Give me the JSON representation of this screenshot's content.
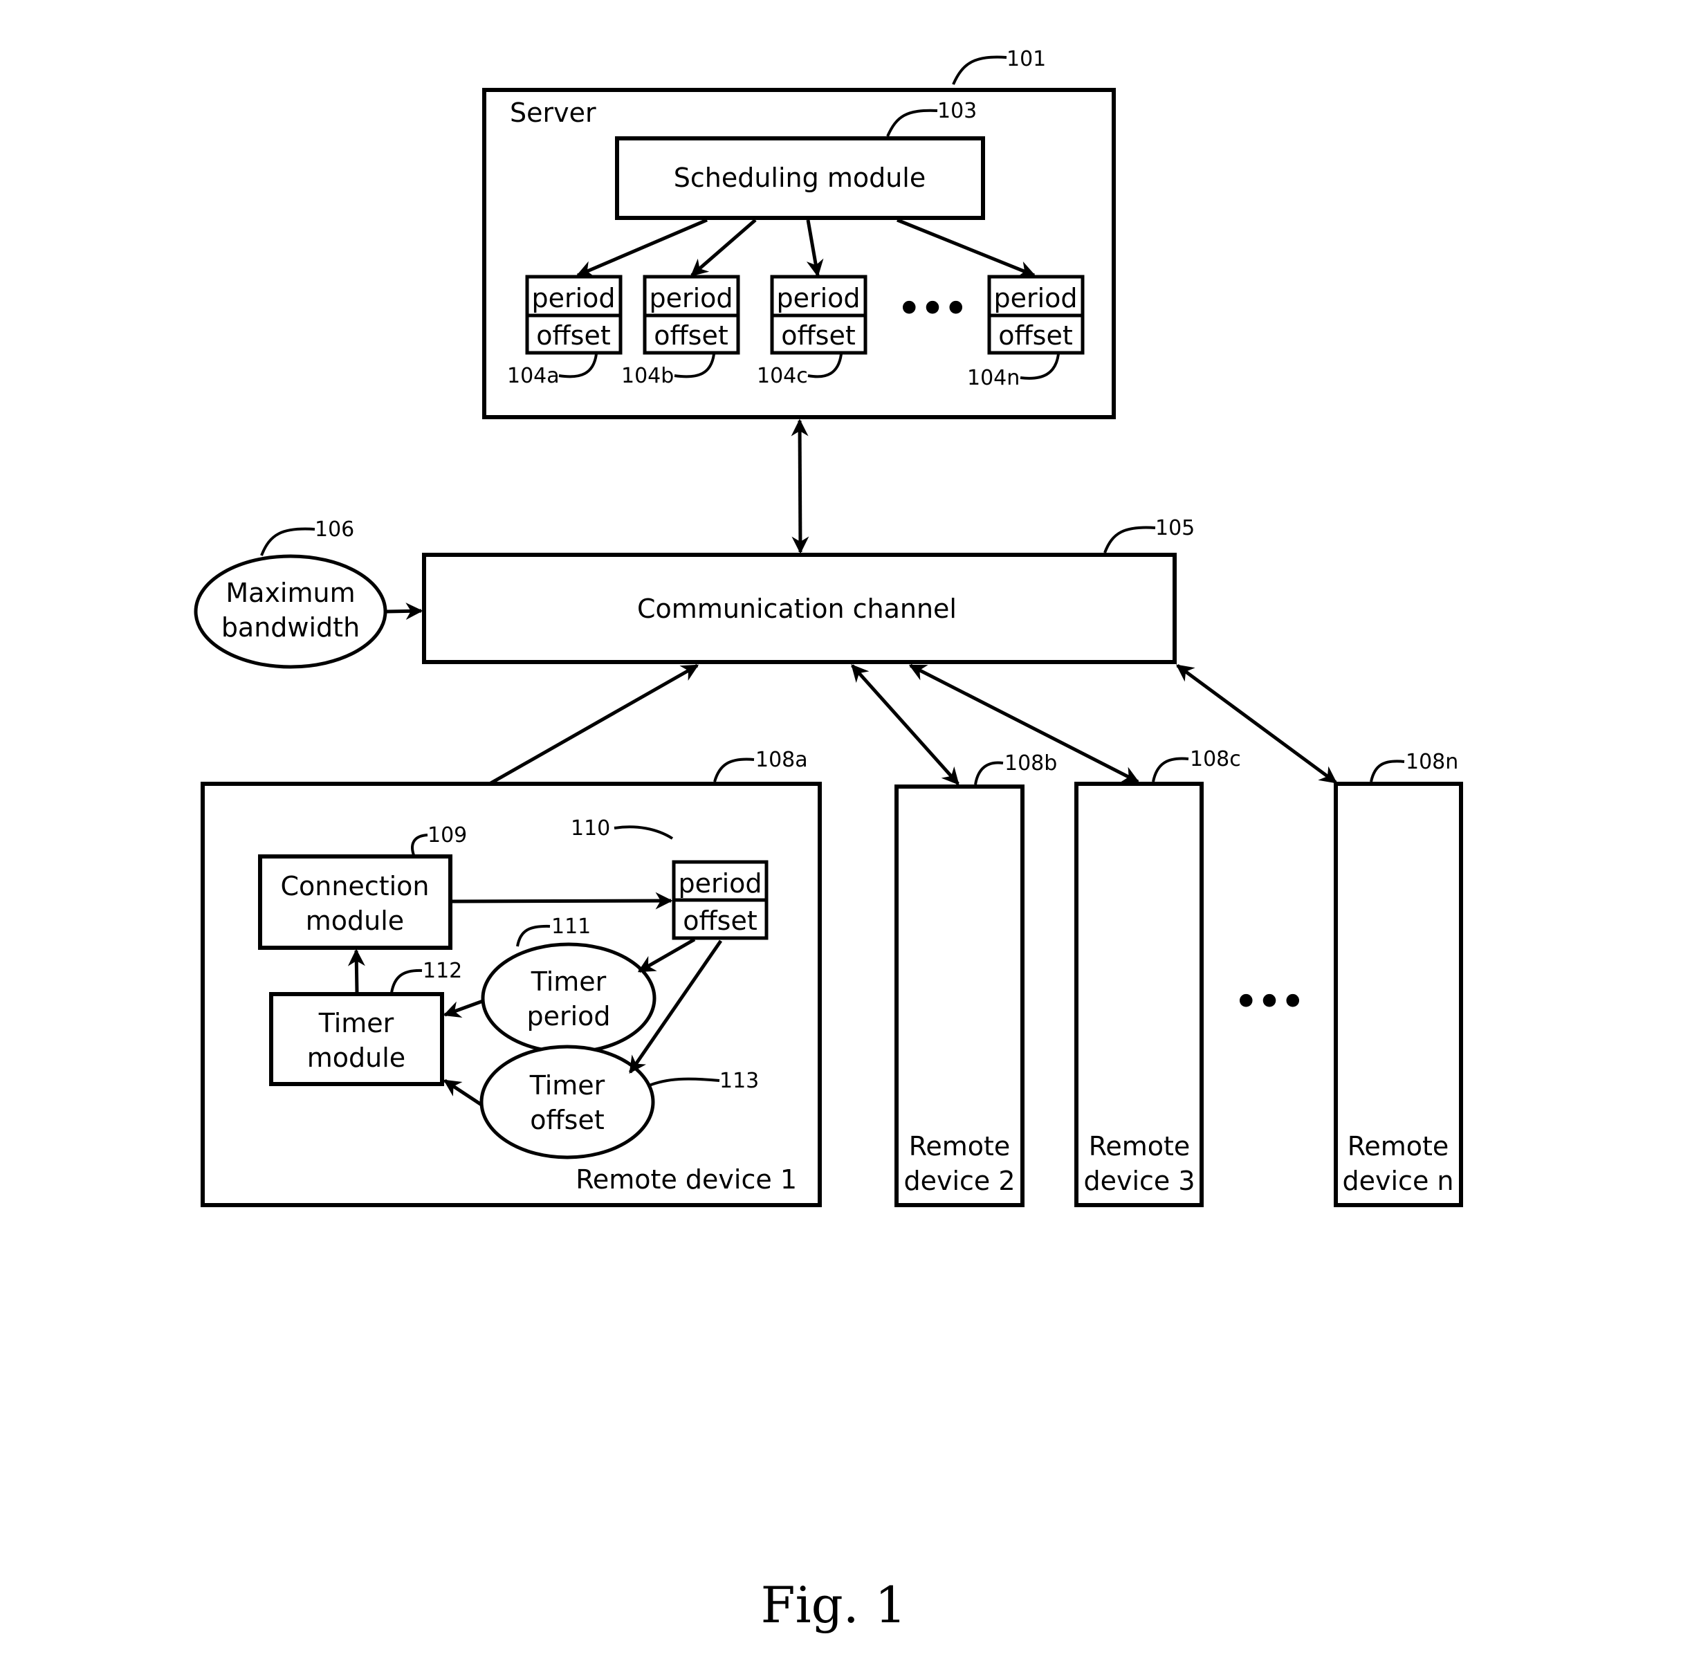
{
  "figure": {
    "caption": "Fig. 1",
    "colors": {
      "ink": "#000000",
      "paper": "#ffffff"
    }
  },
  "server": {
    "label": "Server",
    "ref": "101",
    "scheduling_module": {
      "label": "Scheduling module",
      "ref": "103"
    },
    "registers": [
      {
        "ref": "104a",
        "top": "period",
        "bottom": "offset"
      },
      {
        "ref": "104b",
        "top": "period",
        "bottom": "offset"
      },
      {
        "ref": "104c",
        "top": "period",
        "bottom": "offset"
      },
      {
        "ref": "104n",
        "top": "period",
        "bottom": "offset"
      }
    ],
    "ellipsis": "•••"
  },
  "channel": {
    "label": "Communication channel",
    "ref": "105"
  },
  "bandwidth": {
    "line1": "Maximum",
    "line2": "bandwidth",
    "ref": "106"
  },
  "remote_device_1": {
    "label": "Remote device 1",
    "ref": "108a",
    "connection_module": {
      "line1": "Connection",
      "line2": "module",
      "ref": "109"
    },
    "register": {
      "top": "period",
      "bottom": "offset",
      "ref": "110"
    },
    "timer_period": {
      "line1": "Timer",
      "line2": "period",
      "ref": "111"
    },
    "timer_module": {
      "line1": "Timer",
      "line2": "module",
      "ref": "112"
    },
    "timer_offset": {
      "line1": "Timer",
      "line2": "offset",
      "ref": "113"
    }
  },
  "remote_devices": [
    {
      "line1": "Remote",
      "line2": "device 2",
      "ref": "108b"
    },
    {
      "line1": "Remote",
      "line2": "device 3",
      "ref": "108c"
    },
    {
      "line1": "Remote",
      "line2": "device n",
      "ref": "108n"
    }
  ],
  "devices_ellipsis": "•••"
}
